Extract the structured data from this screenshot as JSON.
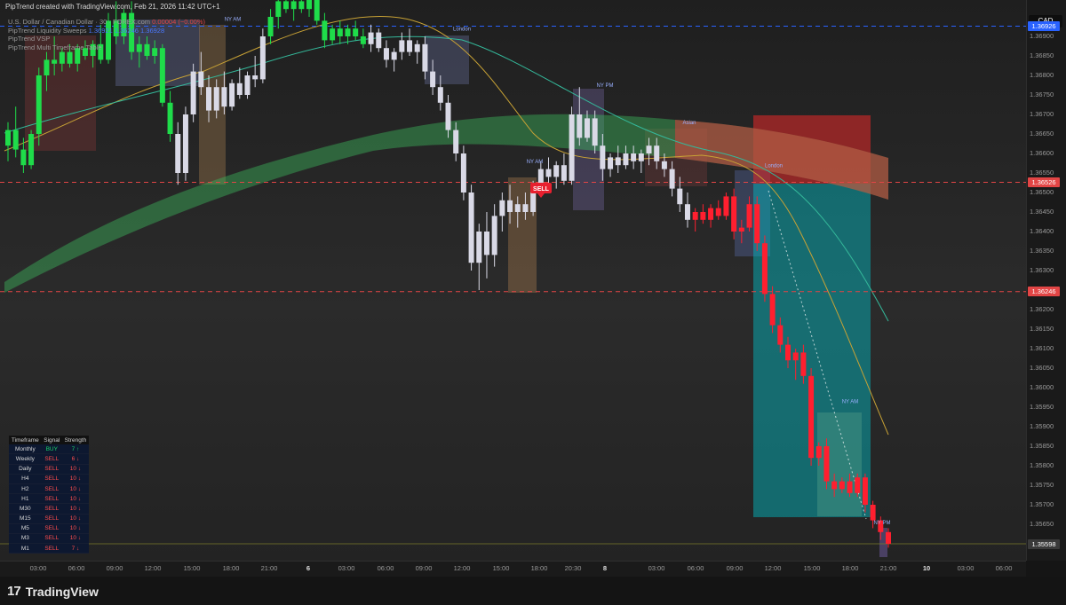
{
  "header": {
    "credit": "PipTrend created with TradingView.com, Feb 21, 2026 11:42 UTC+1",
    "symbol_line": "U.S. Dollar / Canadian Dollar · 30 · FOREX.com",
    "symbol_values": "0.00004 (−0.00%)",
    "indicators": [
      {
        "label": "PipTrend Liquidity Sweeps",
        "value": "1.36921  1.36246  1.36928"
      },
      {
        "label": "PipTrend VSP",
        "value": ""
      },
      {
        "label": "PipTrend Multi Timeframe Table",
        "value": ""
      }
    ],
    "currency": "CAD"
  },
  "colors": {
    "bull": "#1fdc4a",
    "bear": "#ff1f2f",
    "neutral_candle": "#d9d9e6",
    "red_dash": "#e24545",
    "blue_dash": "#2962ff"
  },
  "chart_data": {
    "type": "candlestick",
    "symbol": "USDCAD",
    "timeframe": "30",
    "ylim": [
      1.3558,
      1.3694
    ],
    "y_ticks": [
      "1.36900",
      "1.36850",
      "1.36800",
      "1.36750",
      "1.36700",
      "1.36650",
      "1.36600",
      "1.36550",
      "1.36500",
      "1.36450",
      "1.36400",
      "1.36350",
      "1.36300",
      "1.36250",
      "1.36200",
      "1.36150",
      "1.36100",
      "1.36050",
      "1.36000",
      "1.35950",
      "1.35900",
      "1.35850",
      "1.35800",
      "1.35750",
      "1.35700",
      "1.35650",
      "1.35600"
    ],
    "x_ticks": [
      {
        "label": "03:00",
        "bold": false
      },
      {
        "label": "06:00",
        "bold": false
      },
      {
        "label": "09:00",
        "bold": false
      },
      {
        "label": "12:00",
        "bold": false
      },
      {
        "label": "15:00",
        "bold": false
      },
      {
        "label": "18:00",
        "bold": false
      },
      {
        "label": "21:00",
        "bold": false
      },
      {
        "label": "6",
        "bold": true
      },
      {
        "label": "03:00",
        "bold": false
      },
      {
        "label": "06:00",
        "bold": false
      },
      {
        "label": "09:00",
        "bold": false
      },
      {
        "label": "12:00",
        "bold": false
      },
      {
        "label": "15:00",
        "bold": false
      },
      {
        "label": "18:00",
        "bold": false
      },
      {
        "label": "20:30",
        "bold": false
      },
      {
        "label": "8",
        "bold": true
      },
      {
        "label": "03:00",
        "bold": false
      },
      {
        "label": "06:00",
        "bold": false
      },
      {
        "label": "09:00",
        "bold": false
      },
      {
        "label": "12:00",
        "bold": false
      },
      {
        "label": "15:00",
        "bold": false
      },
      {
        "label": "18:00",
        "bold": false
      },
      {
        "label": "21:00",
        "bold": false
      },
      {
        "label": "10",
        "bold": true
      },
      {
        "label": "03:00",
        "bold": false
      },
      {
        "label": "06:00",
        "bold": false
      }
    ],
    "price_tags": [
      {
        "value": "1.36926",
        "style": "blue",
        "price": 1.36926
      },
      {
        "value": "1.36526",
        "style": "red",
        "price": 1.36526
      },
      {
        "value": "1.36246",
        "style": "red",
        "price": 1.36246
      },
      {
        "value": "1.35598",
        "style": "gray",
        "price": 1.35598
      }
    ],
    "levels": [
      {
        "price": 1.36926,
        "style": "blue"
      },
      {
        "price": 1.36526,
        "style": "red"
      },
      {
        "price": 1.36246,
        "style": "red"
      }
    ],
    "session_labels": [
      {
        "label": "NY AM",
        "price": 1.3694
      },
      {
        "label": "London",
        "price": 1.36915
      },
      {
        "label": "NY PM",
        "price": 1.3677
      },
      {
        "label": "Asian",
        "price": 1.36675
      },
      {
        "label": "NY AM",
        "price": 1.36575
      },
      {
        "label": "London",
        "price": 1.36565
      },
      {
        "label": "NY AM",
        "price": 1.3596
      },
      {
        "label": "NY PM",
        "price": 1.3565
      }
    ],
    "signal_label": "SELL",
    "candles": [
      [
        1.3662,
        1.3668,
        1.3658,
        1.3666,
        "g"
      ],
      [
        1.3666,
        1.3672,
        1.3659,
        1.3661,
        "g"
      ],
      [
        1.3661,
        1.3664,
        1.3655,
        1.3657,
        "g"
      ],
      [
        1.3657,
        1.3666,
        1.3656,
        1.3665,
        "g"
      ],
      [
        1.3665,
        1.3682,
        1.3662,
        1.368,
        "g"
      ],
      [
        1.368,
        1.3686,
        1.3676,
        1.3684,
        "g"
      ],
      [
        1.3684,
        1.369,
        1.368,
        1.3683,
        "g"
      ],
      [
        1.3683,
        1.3687,
        1.3681,
        1.3686,
        "g"
      ],
      [
        1.3686,
        1.3688,
        1.3682,
        1.3683,
        "g"
      ],
      [
        1.3683,
        1.3688,
        1.3681,
        1.3687,
        "g"
      ],
      [
        1.3687,
        1.3689,
        1.3684,
        1.3685,
        "g"
      ],
      [
        1.3685,
        1.3689,
        1.3682,
        1.3688,
        "g"
      ],
      [
        1.3688,
        1.3693,
        1.3683,
        1.3684,
        "g"
      ],
      [
        1.3684,
        1.3696,
        1.3683,
        1.3694,
        "g"
      ],
      [
        1.3694,
        1.3699,
        1.3688,
        1.369,
        "g"
      ],
      [
        1.369,
        1.3697,
        1.3688,
        1.3696,
        "g"
      ],
      [
        1.3696,
        1.3699,
        1.3684,
        1.3686,
        "g"
      ],
      [
        1.3686,
        1.369,
        1.3682,
        1.3688,
        "g"
      ],
      [
        1.3688,
        1.369,
        1.3684,
        1.3685,
        "g"
      ],
      [
        1.3685,
        1.3689,
        1.3683,
        1.3687,
        "g"
      ],
      [
        1.3687,
        1.3688,
        1.3672,
        1.3673,
        "g"
      ],
      [
        1.3673,
        1.3676,
        1.3663,
        1.3665,
        "g"
      ],
      [
        1.3665,
        1.3668,
        1.3652,
        1.3655,
        "w"
      ],
      [
        1.3655,
        1.3672,
        1.3653,
        1.367,
        "w"
      ],
      [
        1.367,
        1.3683,
        1.3668,
        1.3681,
        "w"
      ],
      [
        1.3681,
        1.3686,
        1.3675,
        1.3677,
        "w"
      ],
      [
        1.3677,
        1.368,
        1.3668,
        1.3671,
        "w"
      ],
      [
        1.3671,
        1.3679,
        1.3669,
        1.3677,
        "w"
      ],
      [
        1.3677,
        1.3681,
        1.367,
        1.3672,
        "w"
      ],
      [
        1.3672,
        1.3679,
        1.3671,
        1.3678,
        "w"
      ],
      [
        1.3678,
        1.3682,
        1.3674,
        1.3675,
        "w"
      ],
      [
        1.3675,
        1.3681,
        1.3674,
        1.368,
        "w"
      ],
      [
        1.368,
        1.3685,
        1.3677,
        1.3679,
        "w"
      ],
      [
        1.3679,
        1.3692,
        1.3678,
        1.369,
        "w"
      ],
      [
        1.369,
        1.3697,
        1.3688,
        1.3695,
        "g"
      ],
      [
        1.3695,
        1.3702,
        1.3692,
        1.3699,
        "g"
      ],
      [
        1.3699,
        1.3702,
        1.3696,
        1.3697,
        "g"
      ],
      [
        1.3697,
        1.37,
        1.3694,
        1.3699,
        "g"
      ],
      [
        1.3699,
        1.3701,
        1.3696,
        1.3697,
        "g"
      ],
      [
        1.3697,
        1.3701,
        1.3695,
        1.37,
        "g"
      ],
      [
        1.37,
        1.3702,
        1.3693,
        1.3694,
        "g"
      ],
      [
        1.3694,
        1.3696,
        1.3687,
        1.3689,
        "g"
      ],
      [
        1.3689,
        1.3693,
        1.3688,
        1.3692,
        "g"
      ],
      [
        1.3692,
        1.3694,
        1.3688,
        1.369,
        "g"
      ],
      [
        1.369,
        1.3693,
        1.3688,
        1.3692,
        "g"
      ],
      [
        1.3692,
        1.3694,
        1.3689,
        1.369,
        "g"
      ],
      [
        1.369,
        1.3692,
        1.3687,
        1.3688,
        "g"
      ],
      [
        1.3688,
        1.3693,
        1.3686,
        1.3691,
        "w"
      ],
      [
        1.3691,
        1.3692,
        1.3686,
        1.3687,
        "w"
      ],
      [
        1.3687,
        1.3689,
        1.3682,
        1.3684,
        "w"
      ],
      [
        1.3684,
        1.3687,
        1.3681,
        1.3686,
        "w"
      ],
      [
        1.3686,
        1.3691,
        1.3684,
        1.3689,
        "w"
      ],
      [
        1.3689,
        1.3692,
        1.3685,
        1.3686,
        "w"
      ],
      [
        1.3686,
        1.3689,
        1.3683,
        1.3688,
        "w"
      ],
      [
        1.3688,
        1.369,
        1.3679,
        1.3681,
        "w"
      ],
      [
        1.3681,
        1.3684,
        1.3675,
        1.3677,
        "w"
      ],
      [
        1.3677,
        1.368,
        1.3671,
        1.3673,
        "w"
      ],
      [
        1.3673,
        1.3675,
        1.3664,
        1.3666,
        "w"
      ],
      [
        1.3666,
        1.3668,
        1.3658,
        1.366,
        "w"
      ],
      [
        1.366,
        1.3662,
        1.3648,
        1.365,
        "w"
      ],
      [
        1.365,
        1.3652,
        1.363,
        1.3632,
        "w"
      ],
      [
        1.3632,
        1.3642,
        1.3625,
        1.364,
        "w"
      ],
      [
        1.364,
        1.3645,
        1.3628,
        1.3634,
        "w"
      ],
      [
        1.3634,
        1.3647,
        1.3631,
        1.3644,
        "w"
      ],
      [
        1.3644,
        1.365,
        1.364,
        1.3648,
        "w"
      ],
      [
        1.3648,
        1.3652,
        1.3642,
        1.3645,
        "w"
      ],
      [
        1.3645,
        1.3649,
        1.3641,
        1.3647,
        "w"
      ],
      [
        1.3647,
        1.365,
        1.3643,
        1.3645,
        "w"
      ],
      [
        1.3645,
        1.3653,
        1.3644,
        1.3651,
        "w"
      ],
      [
        1.3651,
        1.3658,
        1.3649,
        1.3656,
        "w"
      ],
      [
        1.3656,
        1.3659,
        1.3652,
        1.3654,
        "w"
      ],
      [
        1.3654,
        1.3658,
        1.3651,
        1.3657,
        "w"
      ],
      [
        1.3657,
        1.366,
        1.3652,
        1.3653,
        "w"
      ],
      [
        1.3653,
        1.3672,
        1.3652,
        1.367,
        "w"
      ],
      [
        1.367,
        1.3677,
        1.3662,
        1.3664,
        "w"
      ],
      [
        1.3664,
        1.3671,
        1.3663,
        1.3669,
        "w"
      ],
      [
        1.3669,
        1.3671,
        1.366,
        1.3662,
        "w"
      ],
      [
        1.3662,
        1.3665,
        1.3653,
        1.3656,
        "w"
      ],
      [
        1.3656,
        1.366,
        1.3654,
        1.3659,
        "w"
      ],
      [
        1.3659,
        1.3662,
        1.3655,
        1.3657,
        "w"
      ],
      [
        1.3657,
        1.3662,
        1.3656,
        1.366,
        "w"
      ],
      [
        1.366,
        1.3662,
        1.3656,
        1.3658,
        "w"
      ],
      [
        1.3658,
        1.3661,
        1.3655,
        1.366,
        "w"
      ],
      [
        1.366,
        1.3664,
        1.3657,
        1.3662,
        "w"
      ],
      [
        1.3662,
        1.3664,
        1.3656,
        1.3658,
        "w"
      ],
      [
        1.3658,
        1.366,
        1.3654,
        1.3656,
        "w"
      ],
      [
        1.3656,
        1.3658,
        1.3649,
        1.3651,
        "w"
      ],
      [
        1.3651,
        1.3654,
        1.3645,
        1.3647,
        "w"
      ],
      [
        1.3647,
        1.365,
        1.3641,
        1.3643,
        "w"
      ],
      [
        1.3643,
        1.3646,
        1.364,
        1.3645,
        "r"
      ],
      [
        1.3645,
        1.3647,
        1.3642,
        1.3643,
        "r"
      ],
      [
        1.3643,
        1.3647,
        1.3641,
        1.3646,
        "r"
      ],
      [
        1.3646,
        1.3648,
        1.3643,
        1.3644,
        "r"
      ],
      [
        1.3644,
        1.365,
        1.3643,
        1.3649,
        "r"
      ],
      [
        1.3649,
        1.3651,
        1.3638,
        1.364,
        "r"
      ],
      [
        1.364,
        1.3643,
        1.3637,
        1.3641,
        "r"
      ],
      [
        1.3641,
        1.3649,
        1.364,
        1.3647,
        "r"
      ],
      [
        1.3647,
        1.3649,
        1.3635,
        1.3637,
        "r"
      ],
      [
        1.3637,
        1.3639,
        1.3622,
        1.3624,
        "r"
      ],
      [
        1.3624,
        1.3626,
        1.3614,
        1.3616,
        "r"
      ],
      [
        1.3616,
        1.3618,
        1.3609,
        1.3611,
        "r"
      ],
      [
        1.3611,
        1.3613,
        1.3605,
        1.3607,
        "r"
      ],
      [
        1.3607,
        1.361,
        1.3602,
        1.3609,
        "r"
      ],
      [
        1.3609,
        1.3611,
        1.3601,
        1.3603,
        "r"
      ],
      [
        1.3603,
        1.3605,
        1.358,
        1.3582,
        "r"
      ],
      [
        1.3582,
        1.3586,
        1.358,
        1.3585,
        "r"
      ],
      [
        1.3585,
        1.3587,
        1.3574,
        1.3576,
        "r"
      ],
      [
        1.3576,
        1.3578,
        1.3572,
        1.3574,
        "r"
      ],
      [
        1.3574,
        1.3577,
        1.3573,
        1.3576,
        "r"
      ],
      [
        1.3576,
        1.3578,
        1.3572,
        1.3573,
        "r"
      ],
      [
        1.3573,
        1.3578,
        1.3572,
        1.3577,
        "r"
      ],
      [
        1.3577,
        1.3578,
        1.3568,
        1.357,
        "r"
      ],
      [
        1.357,
        1.3571,
        1.3564,
        1.3566,
        "r"
      ],
      [
        1.3566,
        1.3567,
        1.3561,
        1.3563,
        "r"
      ],
      [
        1.3563,
        1.3564,
        1.3559,
        1.356,
        "r"
      ]
    ]
  },
  "mtf_table": {
    "headers": [
      "Timeframe",
      "Signal",
      "Strength"
    ],
    "rows": [
      {
        "tf": "Monthly",
        "signal": "BUY",
        "strength": "7 ↑"
      },
      {
        "tf": "Weekly",
        "signal": "SELL",
        "strength": "6 ↓"
      },
      {
        "tf": "Daily",
        "signal": "SELL",
        "strength": "10 ↓"
      },
      {
        "tf": "H4",
        "signal": "SELL",
        "strength": "10 ↓"
      },
      {
        "tf": "H2",
        "signal": "SELL",
        "strength": "10 ↓"
      },
      {
        "tf": "H1",
        "signal": "SELL",
        "strength": "10 ↓"
      },
      {
        "tf": "M30",
        "signal": "SELL",
        "strength": "10 ↓"
      },
      {
        "tf": "M15",
        "signal": "SELL",
        "strength": "10 ↓"
      },
      {
        "tf": "M5",
        "signal": "SELL",
        "strength": "10 ↓"
      },
      {
        "tf": "M3",
        "signal": "SELL",
        "strength": "10 ↓"
      },
      {
        "tf": "M1",
        "signal": "SELL",
        "strength": "7 ↓"
      }
    ]
  },
  "footer": {
    "brand": "TradingView"
  }
}
